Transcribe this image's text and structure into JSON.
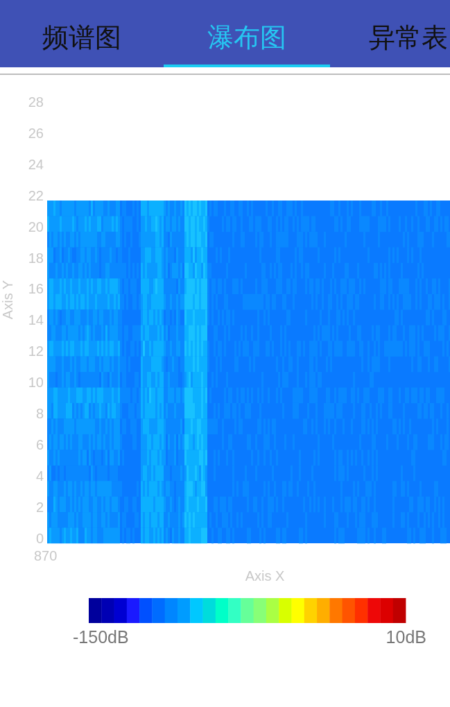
{
  "tabs": [
    {
      "label": "频谱图",
      "selected": false
    },
    {
      "label": "瀑布图",
      "selected": true
    },
    {
      "label": "异常表",
      "selected": false
    }
  ],
  "chart": {
    "y_axis_title": "Axis Y",
    "y_ticks": [
      "28",
      "26",
      "24",
      "22",
      "20",
      "18",
      "16",
      "14",
      "12",
      "10",
      "8",
      "6",
      "4",
      "2",
      "0"
    ],
    "x_ticks": [
      "870"
    ],
    "x_axis_title": "Axis X"
  },
  "colorbar": {
    "min_label": "-150dB",
    "max_label": "10dB"
  }
}
